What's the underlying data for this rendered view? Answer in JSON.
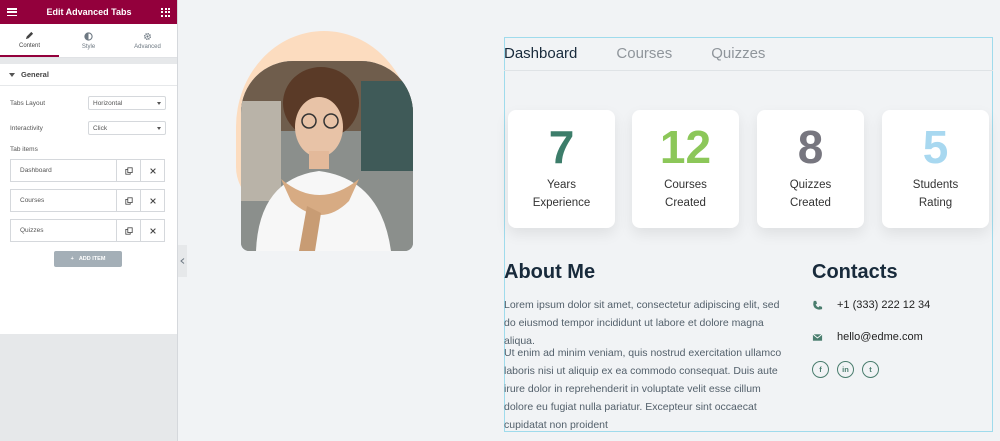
{
  "panel": {
    "title": "Edit Advanced Tabs",
    "tabs": [
      {
        "label": "Content"
      },
      {
        "label": "Style"
      },
      {
        "label": "Advanced"
      }
    ],
    "section_title": "General",
    "controls": {
      "tabs_layout": {
        "label": "Tabs Layout",
        "value": "Horizontal"
      },
      "interactivity": {
        "label": "Interactivity",
        "value": "Click"
      }
    },
    "items_label": "Tab items",
    "items": [
      {
        "label": "Dashboard"
      },
      {
        "label": "Courses"
      },
      {
        "label": "Quizzes"
      }
    ],
    "add_item_label": "ADD ITEM",
    "accent_color": "#93003c"
  },
  "preview": {
    "tabs": [
      {
        "label": "Dashboard"
      },
      {
        "label": "Courses"
      },
      {
        "label": "Quizzes"
      }
    ],
    "stats": [
      {
        "number": "7",
        "line1": "Years",
        "line2": "Experience",
        "color": "#3c7d6a"
      },
      {
        "number": "12",
        "line1": "Courses",
        "line2": "Created",
        "color": "#8cc759"
      },
      {
        "number": "8",
        "line1": "Quizzes",
        "line2": "Created",
        "color": "#77767f"
      },
      {
        "number": "5",
        "line1": "Students",
        "line2": "Rating",
        "color": "#a8d8f0"
      }
    ],
    "about": {
      "title": "About Me",
      "p1": "Lorem ipsum dolor sit amet, consectetur adipiscing elit, sed do eiusmod tempor incididunt ut labore et dolore magna aliqua.",
      "p2": "Ut enim ad minim veniam, quis nostrud exercitation ullamco laboris nisi ut aliquip ex ea commodo consequat. Duis aute irure dolor in reprehenderit in voluptate velit esse cillum dolore eu fugiat nulla pariatur. Excepteur sint occaecat cupidatat non proident"
    },
    "contacts": {
      "title": "Contacts",
      "phone": "+1 (333) 222 12 34",
      "email": "hello@edme.com",
      "socials": [
        {
          "icon": "facebook-icon",
          "glyph": "f"
        },
        {
          "icon": "linkedin-icon",
          "glyph": "in"
        },
        {
          "icon": "twitter-icon",
          "glyph": "t"
        }
      ]
    }
  }
}
